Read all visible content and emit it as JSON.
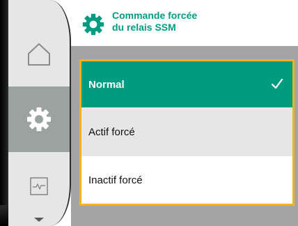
{
  "header": {
    "title_line1": "Commande forcée",
    "title_line2": "du relais SSM",
    "icon": "gear-icon"
  },
  "sidebar": {
    "items": [
      {
        "name": "home",
        "icon": "home-icon",
        "selected": false
      },
      {
        "name": "settings",
        "icon": "gear-icon",
        "selected": true
      },
      {
        "name": "diagnostics",
        "icon": "waveform-icon",
        "selected": false
      }
    ],
    "scroll_icon": "chevron-down-icon"
  },
  "options": {
    "items": [
      {
        "label": "Normal",
        "selected": true
      },
      {
        "label": "Actif forcé",
        "selected": false
      },
      {
        "label": "Inactif forcé",
        "selected": false
      }
    ]
  },
  "colors": {
    "accent_green": "#009c82",
    "focus_orange": "#f4b21c",
    "sidebar_bg": "#e6e6e6",
    "sidebar_selected": "#9aa3a0",
    "content_bg": "#a4a4a4"
  }
}
